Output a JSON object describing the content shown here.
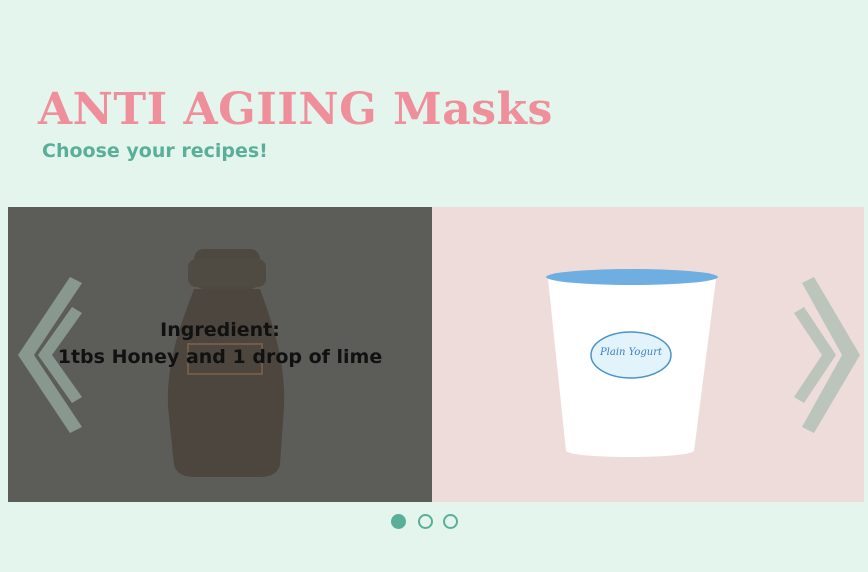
{
  "header": {
    "title": "ANTI AGIING Masks",
    "subtitle": "Choose your recipes!"
  },
  "carousel": {
    "caption_line1": "Ingredient:",
    "caption_line2": "1tbs Honey and 1 drop of lime",
    "slides": [
      {
        "icon": "honey-bottle-icon"
      },
      {
        "icon": "yogurt-cup-icon",
        "label": "Plain Yogurt"
      }
    ],
    "dots_count": 3,
    "active_index": 0
  },
  "colors": {
    "background": "#e3f5ec",
    "title": "#f08f9c",
    "subtitle": "#5aaf9a",
    "slide_bg": "#eddcda",
    "overlay": "#444642",
    "arrow": "#a9bdb2",
    "yogurt_lid": "#6eaee0"
  }
}
